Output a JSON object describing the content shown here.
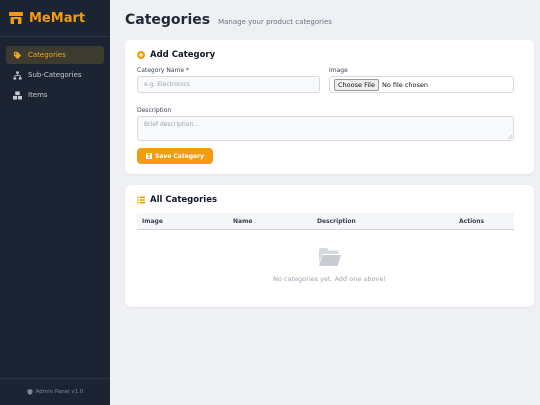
{
  "sidebar": {
    "brand": "MeMart",
    "items": [
      {
        "label": "Categories",
        "icon": "tag-icon",
        "active": true
      },
      {
        "label": "Sub-Categories",
        "icon": "sitemap-icon",
        "active": false
      },
      {
        "label": "Items",
        "icon": "boxes-icon",
        "active": false
      }
    ],
    "footer": "Admin Panel v1.0"
  },
  "header": {
    "title": "Categories",
    "subtitle": "Manage your product categories"
  },
  "add_form": {
    "title": "Add Category",
    "name_label": "Category Name *",
    "name_placeholder": "e.g. Electronics",
    "image_label": "Image",
    "file_button": "Choose File",
    "file_status": "No file chosen",
    "description_label": "Description",
    "description_placeholder": "Brief description...",
    "save_label": "Save Category"
  },
  "list": {
    "title": "All Categories",
    "columns": [
      "Image",
      "Name",
      "Description",
      "Actions"
    ],
    "empty_text": "No categories yet. Add one above!"
  },
  "colors": {
    "accent": "#f39c12",
    "sidebar_bg": "#1c2333",
    "page_bg": "#eef0f4"
  }
}
